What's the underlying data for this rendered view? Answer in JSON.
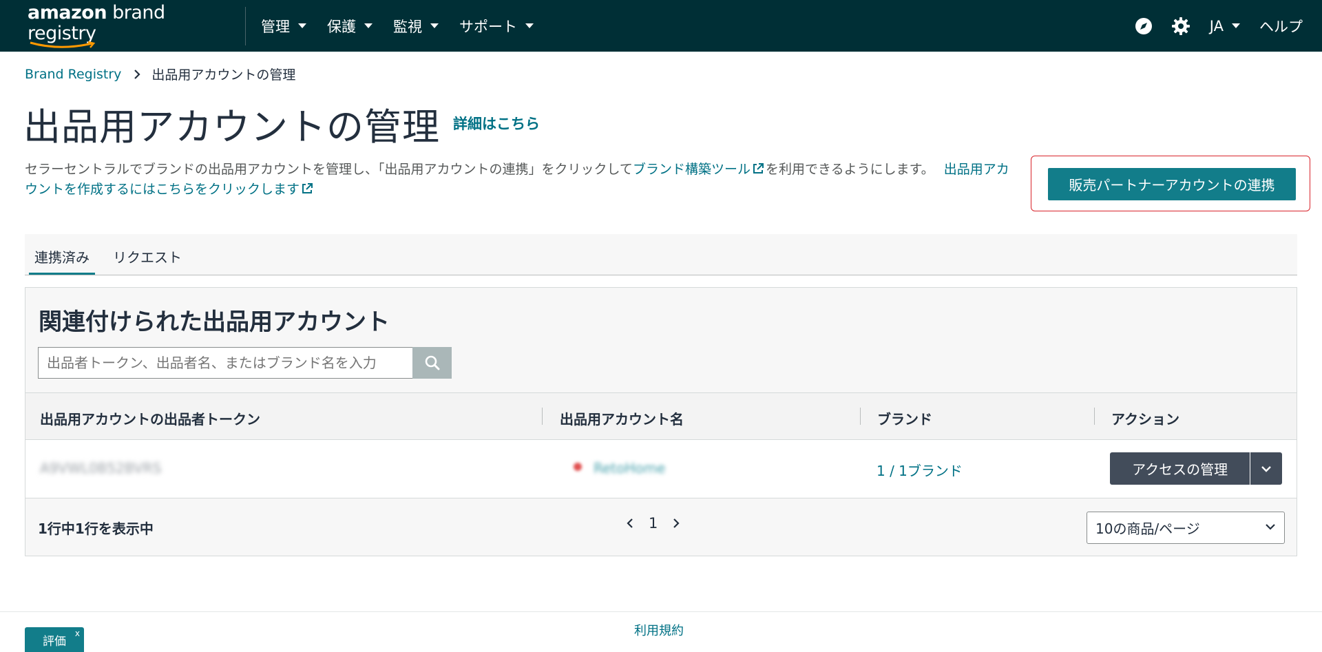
{
  "header": {
    "logo_prefix": "amazon",
    "logo_suffix": " brand registry",
    "menu": [
      {
        "label": "管理"
      },
      {
        "label": "保護"
      },
      {
        "label": "監視"
      },
      {
        "label": "サポート"
      }
    ],
    "language": "JA",
    "help": "ヘルプ",
    "icons": [
      "compass-icon",
      "gear-icon"
    ]
  },
  "breadcrumb": {
    "root": "Brand Registry",
    "current": "出品用アカウントの管理"
  },
  "page": {
    "title": "出品用アカウントの管理",
    "learn_more": "詳細はこちら",
    "description_part1": "セラーセントラルでブランドの出品用アカウントを管理し、「出品用アカウントの連携」をクリックして",
    "description_link1": "ブランド構築ツール",
    "description_part2": "を利用できるようにします。",
    "description_link2": "出品用アカウントを作成するにはこちらをクリックします",
    "primary_button": "販売パートナーアカウントの連携"
  },
  "tabs": [
    {
      "label": "連携済み",
      "active": true
    },
    {
      "label": "リクエスト",
      "active": false
    }
  ],
  "panel": {
    "title": "関連付けられた出品用アカウント",
    "search_placeholder": "出品者トークン、出品者名、またはブランド名を入力",
    "columns": [
      "出品用アカウントの出品者トークン",
      "出品用アカウント名",
      "ブランド",
      "アクション"
    ],
    "rows": [
      {
        "token": "A9VWL0B52BVRS",
        "account_name": "RetoHome",
        "brands": "1 / 1ブランド",
        "action": "アクセスの管理"
      }
    ],
    "row_count": "1行中1行を表示中",
    "page_number": "1",
    "page_size": "10の商品/ページ"
  },
  "footer": {
    "terms": "利用規約",
    "feedback": "評価",
    "feedback_close": "x"
  },
  "colors": {
    "nav_bg": "#002f36",
    "accent": "#127d8a",
    "link": "#007185",
    "highlight_border": "#d8232a"
  }
}
